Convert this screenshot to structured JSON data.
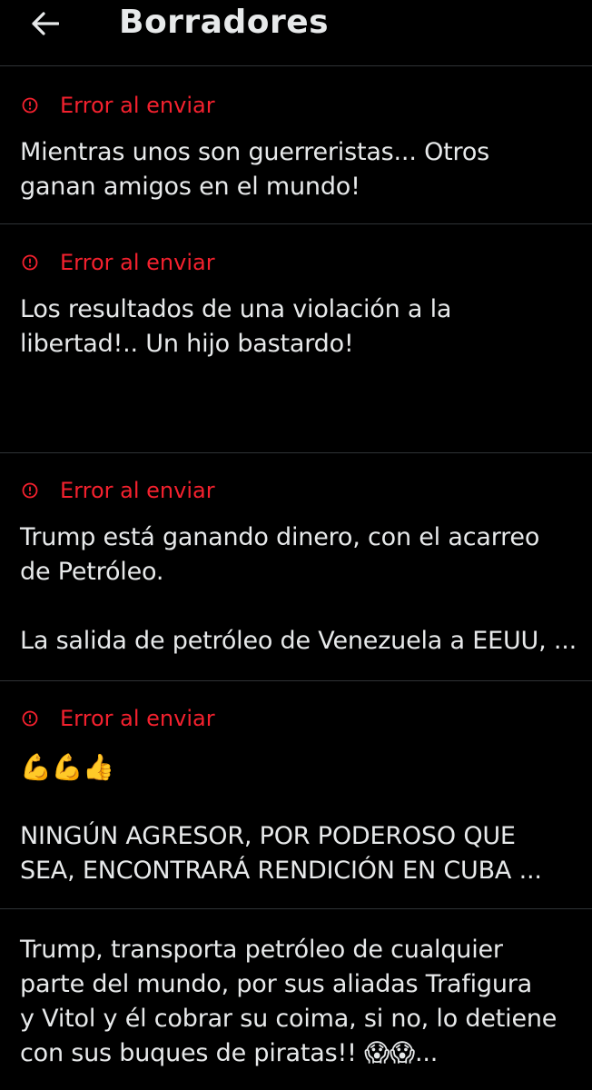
{
  "header": {
    "back_icon": "arrow-left-icon",
    "title": "Borradores"
  },
  "colors": {
    "background": "#000000",
    "text": "#e7e9ea",
    "error": "#f4212e",
    "divider": "#2f3336"
  },
  "drafts": [
    {
      "status_icon": "alert-circle-icon",
      "status": "Error al enviar",
      "text": "Mientras unos son guerreristas... Otros\nganan amigos en el mundo!"
    },
    {
      "status_icon": "alert-circle-icon",
      "status": "Error al enviar",
      "text": "Los resultados de una violación a la\nlibertad!.. Un hijo bastardo!"
    },
    {
      "status_icon": "alert-circle-icon",
      "status": "Error al enviar",
      "text": "Trump está ganando dinero, con el acarreo\nde Petróleo.\n\nLa salida de petróleo de Venezuela a EEUU, ..."
    },
    {
      "status_icon": "alert-circle-icon",
      "status": "Error al enviar",
      "emoji": "💪💪👍",
      "text": "NINGÚN AGRESOR, POR PODEROSO QUE\nSEA, ENCONTRARÁ RENDICIÓN EN CUBA ..."
    },
    {
      "text": "Trump, transporta petróleo de cualquier\nparte del mundo, por sus aliadas Trafigura\ny Vitol y él cobrar su coima, si no, lo detiene\ncon sus buques de piratas!! 😱😱..."
    }
  ]
}
